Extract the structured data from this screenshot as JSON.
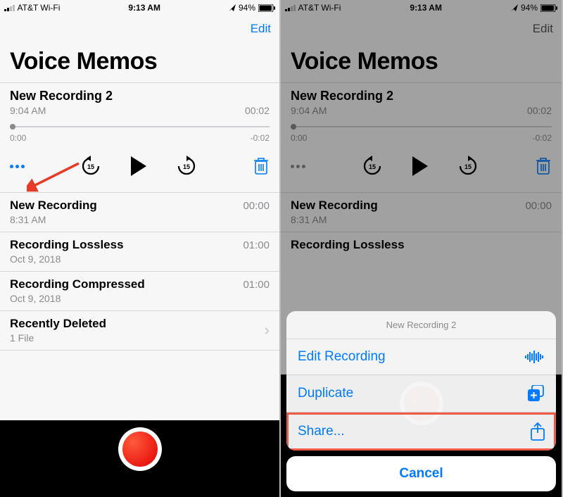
{
  "status": {
    "carrier": "AT&T Wi-Fi",
    "time": "9:13 AM",
    "battery": "94%"
  },
  "nav": {
    "edit": "Edit"
  },
  "title": "Voice Memos",
  "expanded": {
    "name": "New Recording 2",
    "time": "9:04 AM",
    "duration": "00:02",
    "scrub_start": "0:00",
    "scrub_end": "-0:02"
  },
  "list": [
    {
      "name": "New Recording",
      "sub": "8:31 AM",
      "dur": "00:00"
    },
    {
      "name": "Recording Lossless",
      "sub": "Oct 9, 2018",
      "dur": "01:00"
    },
    {
      "name": "Recording Compressed",
      "sub": "Oct 9, 2018",
      "dur": "01:00"
    }
  ],
  "recently": {
    "name": "Recently Deleted",
    "sub": "1 File"
  },
  "sheet": {
    "title": "New Recording 2",
    "edit": "Edit Recording",
    "duplicate": "Duplicate",
    "share": "Share...",
    "cancel": "Cancel"
  }
}
